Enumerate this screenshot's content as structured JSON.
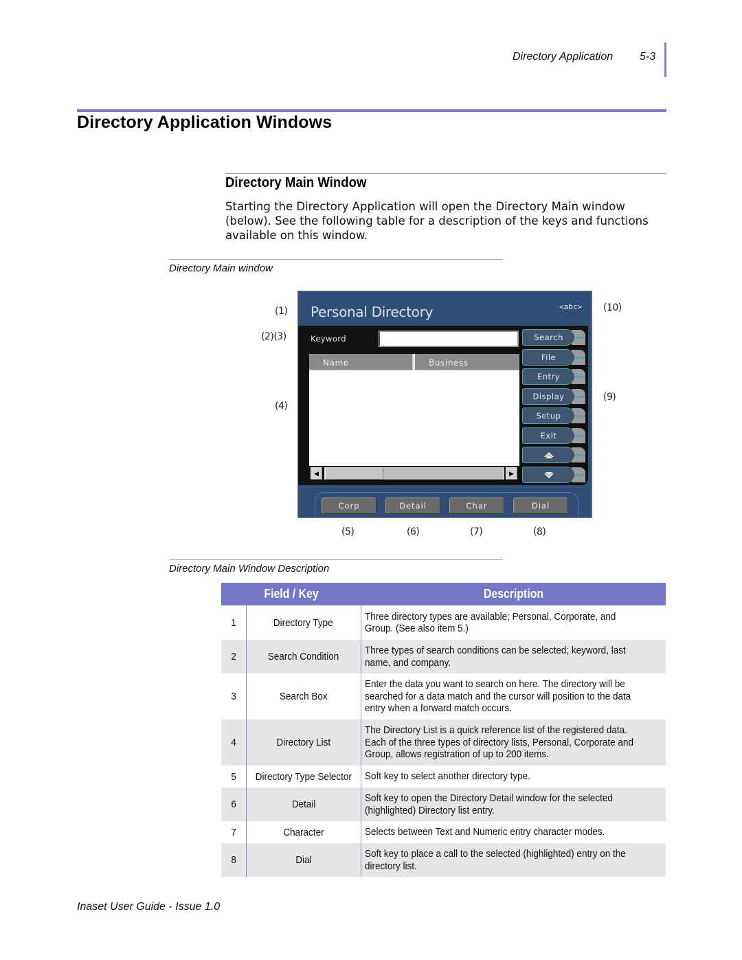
{
  "header": {
    "section": "Directory Application",
    "page_number": "5-3"
  },
  "title": "Directory Application Windows",
  "subsection": {
    "title": "Directory Main Window",
    "intro": "Starting the Directory Application will open the Directory Main window (below). See the following table for a description of the keys and functions available on this window."
  },
  "figure": {
    "caption": "Directory Main window",
    "screen": {
      "title": "Personal Directory",
      "mode_indicator": "<abc>",
      "keyword_label": "Keyword",
      "keyword_value": "",
      "columns": [
        "Name",
        "Business"
      ],
      "side_keys": [
        {
          "label": "Search",
          "icon": null
        },
        {
          "label": "File",
          "icon": null
        },
        {
          "label": "Entry",
          "icon": null
        },
        {
          "label": "Display",
          "icon": null
        },
        {
          "label": "Setup",
          "icon": null
        },
        {
          "label": "Exit",
          "icon": null
        },
        {
          "label": "",
          "icon": "scroll-up-icon"
        },
        {
          "label": "",
          "icon": "scroll-down-icon"
        }
      ],
      "soft_keys": [
        "Corp",
        "Detail",
        "Char",
        "Dial"
      ]
    },
    "callouts": {
      "c1": "(1)",
      "c23": "(2)(3)",
      "c4": "(4)",
      "c5": "(5)",
      "c6": "(6)",
      "c7": "(7)",
      "c8": "(8)",
      "c9": "(9)",
      "c10": "(10)"
    }
  },
  "table": {
    "caption": "Directory Main Window Description",
    "headers": [
      "Field / Key",
      "Description"
    ],
    "rows": [
      {
        "num": "1",
        "field": "Directory Type",
        "desc": [
          "Three directory types are available; Personal, Corporate, and",
          "Group. (See also item 5.)"
        ]
      },
      {
        "num": "2",
        "field": "Search Condition",
        "desc": [
          "Three types of search conditions can be selected; keyword, last",
          "name, and company."
        ]
      },
      {
        "num": "3",
        "field": "Search Box",
        "desc": [
          "Enter the data you want to search on here. The directory will be",
          "searched for a data match and the cursor will position to the data",
          "entry when a forward match occurs."
        ]
      },
      {
        "num": "4",
        "field": "Directory List",
        "desc": [
          "The Directory List is a quick reference list of the registered data.",
          "Each of the three types of directory lists, Personal, Corporate and",
          "Group, allows registration of up to 200 items."
        ]
      },
      {
        "num": "5",
        "field": "Directory Type Selector",
        "desc": [
          "Soft key to select another directory type."
        ]
      },
      {
        "num": "6",
        "field": "Detail",
        "desc": [
          "Soft key to open the Directory Detail window for the selected",
          "(highlighted) Directory list entry."
        ]
      },
      {
        "num": "7",
        "field": "Character",
        "desc": [
          "Selects between Text and Numeric entry character modes."
        ]
      },
      {
        "num": "8",
        "field": "Dial",
        "desc": [
          "Soft key to place a call to the selected (highlighted) entry on the",
          "directory list."
        ]
      }
    ]
  },
  "footer": "Inaset User Guide - Issue 1.0"
}
